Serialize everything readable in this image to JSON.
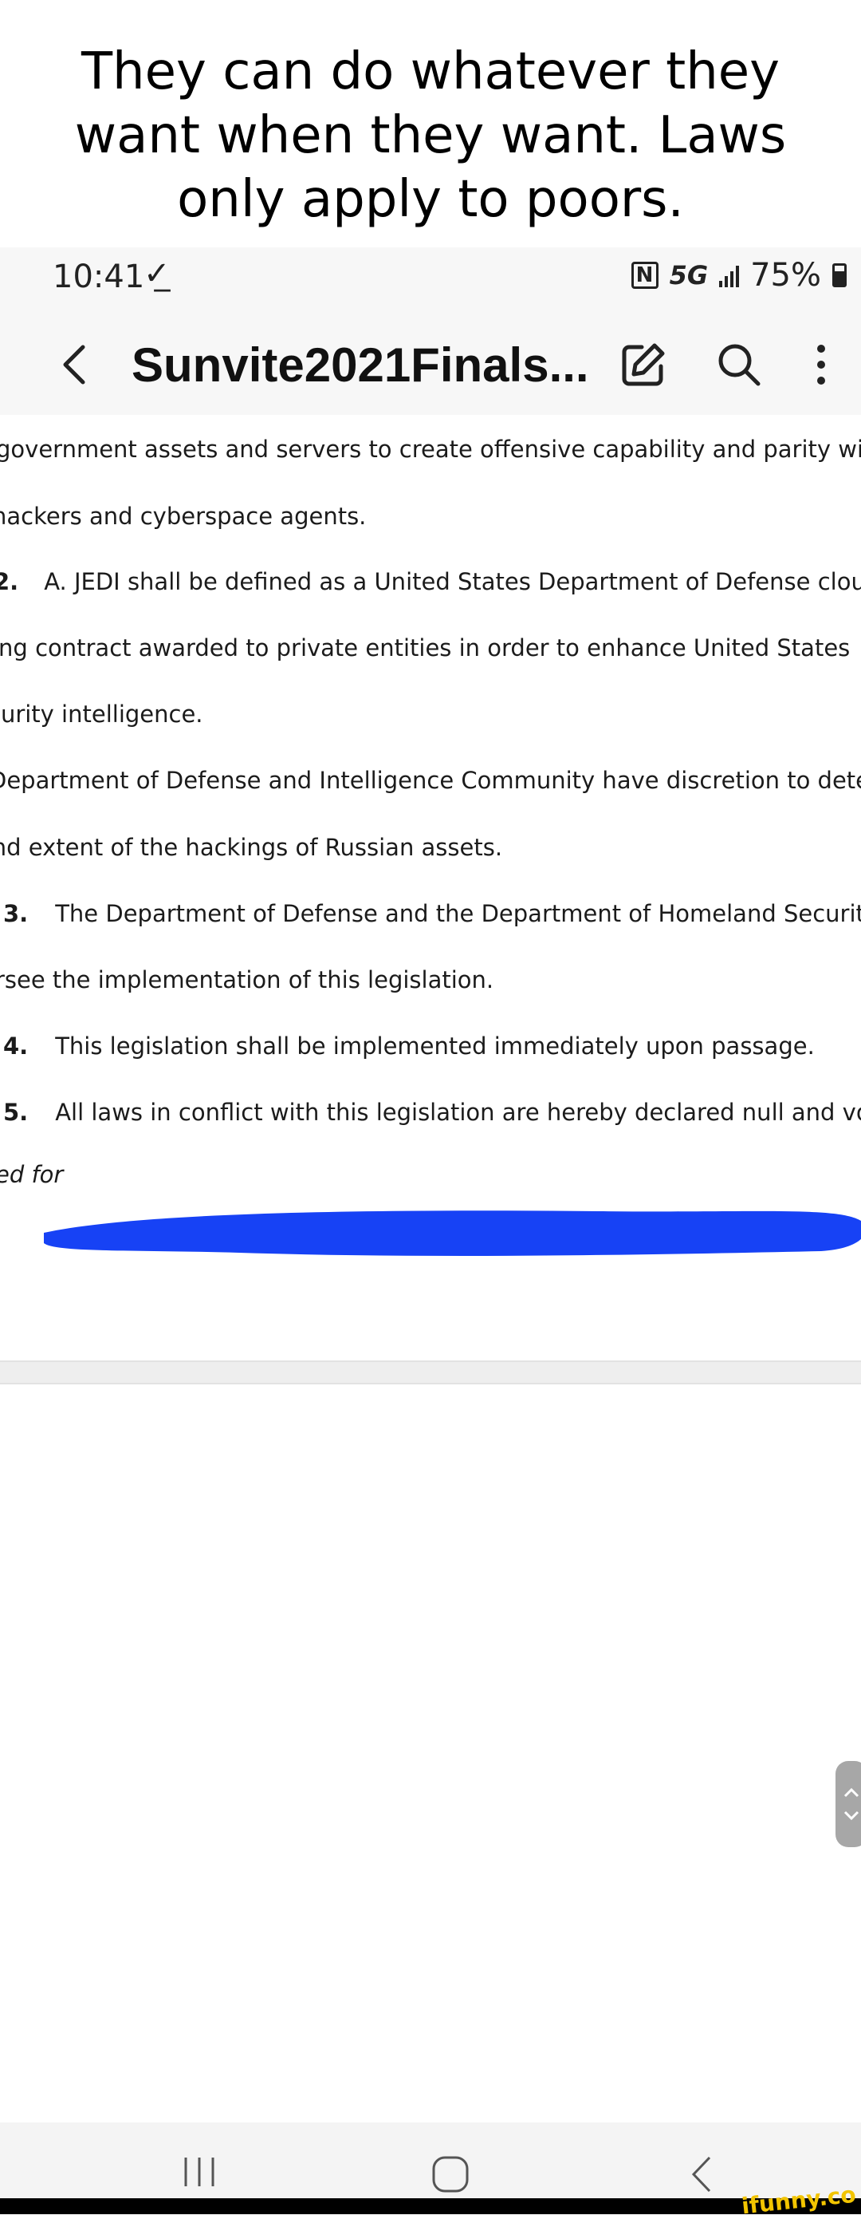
{
  "caption": "They can do whatever they want when they want. Laws only apply to poors.",
  "status_bar": {
    "time": "10:41",
    "network": "5G",
    "battery": "75%"
  },
  "app_bar": {
    "title": "Sunvite2021Finals..."
  },
  "document": {
    "lines": [
      {
        "num": "",
        "text": "government assets and servers to create offensive capability and parity with"
      },
      {
        "num": "",
        "text": "hackers and cyberspace agents."
      },
      {
        "num": "2.",
        "text": "A. JEDI shall be defined as a United States Department of Defense cloud"
      },
      {
        "num": "",
        "text": "ing contract awarded to private entities in order to enhance United States"
      },
      {
        "num": "",
        "text": "curity intelligence."
      },
      {
        "num": "",
        "text": "Department of Defense and Intelligence Community have discretion to determine"
      },
      {
        "num": "",
        "text": "and extent of the hackings of Russian assets."
      },
      {
        "num": "3.",
        "text": "The Department of Defense and the Department of Homeland Security"
      },
      {
        "num": "",
        "text": "rsee the implementation of this legislation."
      },
      {
        "num": "4.",
        "text": "This legislation shall be implemented immediately upon passage."
      },
      {
        "num": "5.",
        "text": "All laws in conflict with this legislation are hereby declared null and void."
      }
    ],
    "redacted_fragment": "ed for"
  },
  "watermark": "ifunny.co",
  "colors": {
    "redaction": "#1742f5",
    "watermark": "#f2c400"
  }
}
